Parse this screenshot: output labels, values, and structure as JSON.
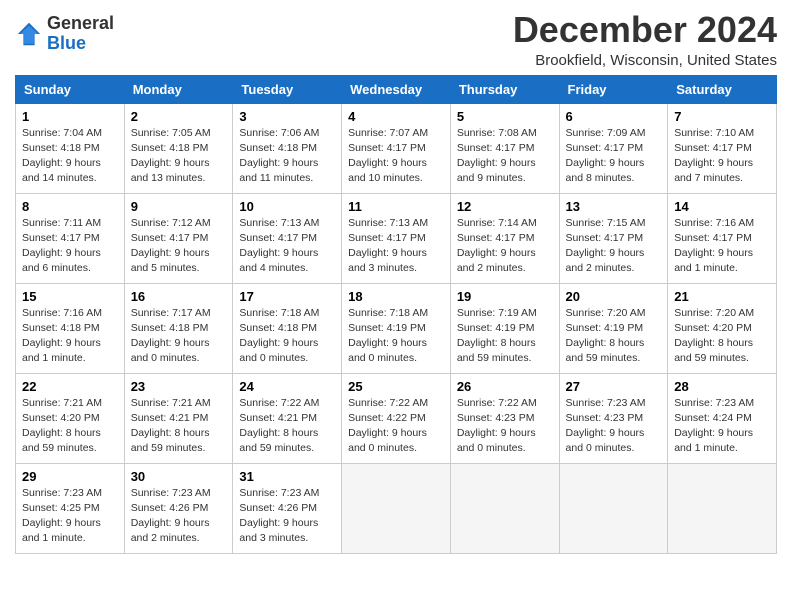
{
  "logo": {
    "general": "General",
    "blue": "Blue"
  },
  "title": "December 2024",
  "location": "Brookfield, Wisconsin, United States",
  "days_of_week": [
    "Sunday",
    "Monday",
    "Tuesday",
    "Wednesday",
    "Thursday",
    "Friday",
    "Saturday"
  ],
  "weeks": [
    [
      {
        "day": 1,
        "sunrise": "7:04 AM",
        "sunset": "4:18 PM",
        "daylight": "9 hours and 14 minutes."
      },
      {
        "day": 2,
        "sunrise": "7:05 AM",
        "sunset": "4:18 PM",
        "daylight": "9 hours and 13 minutes."
      },
      {
        "day": 3,
        "sunrise": "7:06 AM",
        "sunset": "4:18 PM",
        "daylight": "9 hours and 11 minutes."
      },
      {
        "day": 4,
        "sunrise": "7:07 AM",
        "sunset": "4:17 PM",
        "daylight": "9 hours and 10 minutes."
      },
      {
        "day": 5,
        "sunrise": "7:08 AM",
        "sunset": "4:17 PM",
        "daylight": "9 hours and 9 minutes."
      },
      {
        "day": 6,
        "sunrise": "7:09 AM",
        "sunset": "4:17 PM",
        "daylight": "9 hours and 8 minutes."
      },
      {
        "day": 7,
        "sunrise": "7:10 AM",
        "sunset": "4:17 PM",
        "daylight": "9 hours and 7 minutes."
      }
    ],
    [
      {
        "day": 8,
        "sunrise": "7:11 AM",
        "sunset": "4:17 PM",
        "daylight": "9 hours and 6 minutes."
      },
      {
        "day": 9,
        "sunrise": "7:12 AM",
        "sunset": "4:17 PM",
        "daylight": "9 hours and 5 minutes."
      },
      {
        "day": 10,
        "sunrise": "7:13 AM",
        "sunset": "4:17 PM",
        "daylight": "9 hours and 4 minutes."
      },
      {
        "day": 11,
        "sunrise": "7:13 AM",
        "sunset": "4:17 PM",
        "daylight": "9 hours and 3 minutes."
      },
      {
        "day": 12,
        "sunrise": "7:14 AM",
        "sunset": "4:17 PM",
        "daylight": "9 hours and 2 minutes."
      },
      {
        "day": 13,
        "sunrise": "7:15 AM",
        "sunset": "4:17 PM",
        "daylight": "9 hours and 2 minutes."
      },
      {
        "day": 14,
        "sunrise": "7:16 AM",
        "sunset": "4:17 PM",
        "daylight": "9 hours and 1 minute."
      }
    ],
    [
      {
        "day": 15,
        "sunrise": "7:16 AM",
        "sunset": "4:18 PM",
        "daylight": "9 hours and 1 minute."
      },
      {
        "day": 16,
        "sunrise": "7:17 AM",
        "sunset": "4:18 PM",
        "daylight": "9 hours and 0 minutes."
      },
      {
        "day": 17,
        "sunrise": "7:18 AM",
        "sunset": "4:18 PM",
        "daylight": "9 hours and 0 minutes."
      },
      {
        "day": 18,
        "sunrise": "7:18 AM",
        "sunset": "4:19 PM",
        "daylight": "9 hours and 0 minutes."
      },
      {
        "day": 19,
        "sunrise": "7:19 AM",
        "sunset": "4:19 PM",
        "daylight": "8 hours and 59 minutes."
      },
      {
        "day": 20,
        "sunrise": "7:20 AM",
        "sunset": "4:19 PM",
        "daylight": "8 hours and 59 minutes."
      },
      {
        "day": 21,
        "sunrise": "7:20 AM",
        "sunset": "4:20 PM",
        "daylight": "8 hours and 59 minutes."
      }
    ],
    [
      {
        "day": 22,
        "sunrise": "7:21 AM",
        "sunset": "4:20 PM",
        "daylight": "8 hours and 59 minutes."
      },
      {
        "day": 23,
        "sunrise": "7:21 AM",
        "sunset": "4:21 PM",
        "daylight": "8 hours and 59 minutes."
      },
      {
        "day": 24,
        "sunrise": "7:22 AM",
        "sunset": "4:21 PM",
        "daylight": "8 hours and 59 minutes."
      },
      {
        "day": 25,
        "sunrise": "7:22 AM",
        "sunset": "4:22 PM",
        "daylight": "9 hours and 0 minutes."
      },
      {
        "day": 26,
        "sunrise": "7:22 AM",
        "sunset": "4:23 PM",
        "daylight": "9 hours and 0 minutes."
      },
      {
        "day": 27,
        "sunrise": "7:23 AM",
        "sunset": "4:23 PM",
        "daylight": "9 hours and 0 minutes."
      },
      {
        "day": 28,
        "sunrise": "7:23 AM",
        "sunset": "4:24 PM",
        "daylight": "9 hours and 1 minute."
      }
    ],
    [
      {
        "day": 29,
        "sunrise": "7:23 AM",
        "sunset": "4:25 PM",
        "daylight": "9 hours and 1 minute."
      },
      {
        "day": 30,
        "sunrise": "7:23 AM",
        "sunset": "4:26 PM",
        "daylight": "9 hours and 2 minutes."
      },
      {
        "day": 31,
        "sunrise": "7:23 AM",
        "sunset": "4:26 PM",
        "daylight": "9 hours and 3 minutes."
      },
      null,
      null,
      null,
      null
    ]
  ],
  "labels": {
    "sunrise": "Sunrise:",
    "sunset": "Sunset:",
    "daylight": "Daylight:"
  }
}
